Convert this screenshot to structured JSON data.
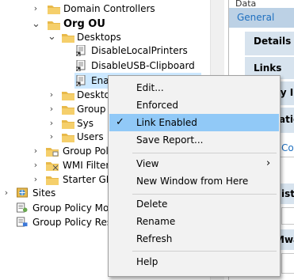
{
  "tree": {
    "items": [
      {
        "label": "Domain Controllers",
        "chevron": "›"
      },
      {
        "label": "Org OU",
        "chevron": "⌄"
      },
      {
        "label": "Desktops",
        "chevron": "⌄"
      },
      {
        "label": "DisableLocalPrinters"
      },
      {
        "label": "DisableUSB-Clipboard"
      },
      {
        "label": "EnableTe"
      },
      {
        "label": "Desktop",
        "chevron": "›"
      },
      {
        "label": "Group S",
        "chevron": "›"
      },
      {
        "label": "Sys",
        "chevron": "›"
      },
      {
        "label": "Users",
        "chevron": "›"
      },
      {
        "label": "Group Polic",
        "chevron": "›"
      },
      {
        "label": "WMI Filters",
        "chevron": "›"
      },
      {
        "label": "Starter GPO",
        "chevron": "›"
      },
      {
        "label": "Sites",
        "chevron": "›"
      },
      {
        "label": "Group Policy Mod"
      },
      {
        "label": "Group Policy Resu"
      }
    ]
  },
  "right": {
    "collected": "Data collected",
    "general": "General",
    "details": "Details",
    "links": "Links",
    "frag_ty": "ty I",
    "frag_atio": "atio",
    "frag_co": "Co",
    "frag_istr": "istr",
    "frag_mwa": "Mwa"
  },
  "menu": {
    "items": [
      {
        "label": "Edit..."
      },
      {
        "label": "Enforced"
      },
      {
        "label": "Link Enabled",
        "checked": "✓"
      },
      {
        "label": "Save Report..."
      },
      {
        "label": "View",
        "arrow": "›"
      },
      {
        "label": "New Window from Here"
      },
      {
        "label": "Delete"
      },
      {
        "label": "Rename"
      },
      {
        "label": "Refresh"
      },
      {
        "label": "Help"
      }
    ]
  },
  "colors": {
    "folder": "#e8b94a",
    "highlight": "#cce8ff",
    "menu_hover": "#91c9f7",
    "tab": "#d7e3ee",
    "link_blue": "#1e6fbf"
  }
}
